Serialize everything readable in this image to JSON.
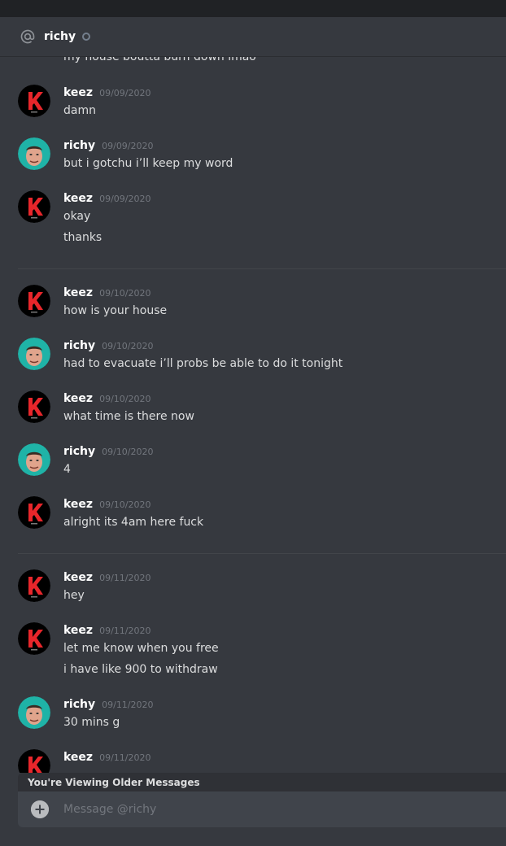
{
  "header": {
    "channel_name": "richy",
    "status": "offline"
  },
  "colors": {
    "background": "#36393f",
    "titlebar": "#202225",
    "timestamp": "#72767d",
    "keez_avatar": "#000000",
    "keez_logo": "#e8262b",
    "richy_avatar": "#1fb3a7"
  },
  "messages": {
    "partial_line": "my house boutta burn down lmao",
    "m1": {
      "author": "keez",
      "timestamp": "09/09/2020",
      "lines": [
        "damn"
      ]
    },
    "m2": {
      "author": "richy",
      "timestamp": "09/09/2020",
      "lines": [
        "but i gotchu i’ll keep my word"
      ]
    },
    "m3": {
      "author": "keez",
      "timestamp": "09/09/2020",
      "lines": [
        "okay",
        "thanks"
      ]
    },
    "m4": {
      "author": "keez",
      "timestamp": "09/10/2020",
      "lines": [
        "how is your house"
      ]
    },
    "m5": {
      "author": "richy",
      "timestamp": "09/10/2020",
      "lines": [
        "had to evacuate i’ll probs be able to do it tonight"
      ]
    },
    "m6": {
      "author": "keez",
      "timestamp": "09/10/2020",
      "lines": [
        "what time is there now"
      ]
    },
    "m7": {
      "author": "richy",
      "timestamp": "09/10/2020",
      "lines": [
        "4"
      ]
    },
    "m8": {
      "author": "keez",
      "timestamp": "09/10/2020",
      "lines": [
        "alright its 4am here fuck"
      ]
    },
    "m9": {
      "author": "keez",
      "timestamp": "09/11/2020",
      "lines": [
        "hey"
      ]
    },
    "m10": {
      "author": "keez",
      "timestamp": "09/11/2020",
      "lines": [
        "let me know when you free",
        "i have like 900 to withdraw"
      ]
    },
    "m11": {
      "author": "richy",
      "timestamp": "09/11/2020",
      "lines": [
        "30 mins g"
      ]
    },
    "m12": {
      "author": "keez",
      "timestamp": "09/11/2020",
      "lines": []
    }
  },
  "older_banner": "You're Viewing Older Messages",
  "composer": {
    "placeholder": "Message @richy"
  },
  "icons": {
    "header": "at-sign-icon",
    "status": "offline-status-icon",
    "attach": "plus-circle-icon"
  }
}
